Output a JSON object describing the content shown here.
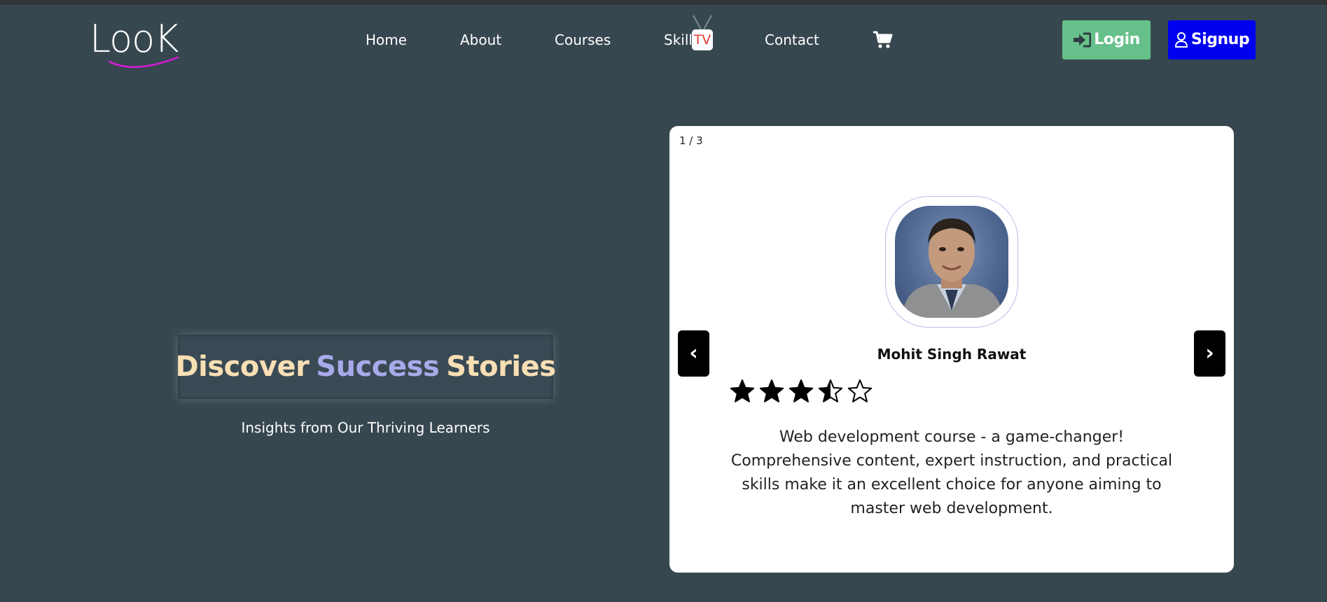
{
  "header": {
    "logo_text": "LooK",
    "nav": [
      {
        "label": "Home"
      },
      {
        "label": "About"
      },
      {
        "label": "Courses"
      },
      {
        "label": "Skill",
        "badge": "TV"
      },
      {
        "label": "Contact"
      }
    ],
    "cart_icon": "cart-icon",
    "login_label": "Login",
    "signup_label": "Signup"
  },
  "hero": {
    "title_words": [
      "Discover",
      "Success",
      "Stories"
    ],
    "subtitle": "Insights from Our Thriving Learners"
  },
  "testimonial": {
    "counter": "1 / 3",
    "name": "Mohit Singh Rawat",
    "rating": 3.5,
    "rating_max": 5,
    "quote": "Web development course - a game-changer! Comprehensive content, expert instruction, and practical skills make it an excellent choice for anyone aiming to master web development.",
    "prev_label": "‹",
    "next_label": "›"
  },
  "colors": {
    "background": "#37474f",
    "login_button": "#66c08a",
    "signup_button": "#0000f0",
    "title_cream": "#f8dfb4",
    "title_lavender": "#a9aaea",
    "tv_red": "#e53935"
  }
}
